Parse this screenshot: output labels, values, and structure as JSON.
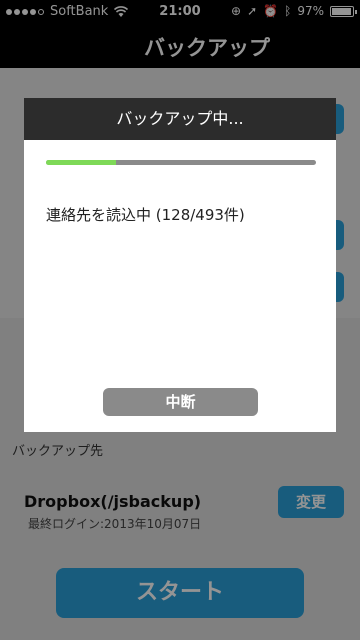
{
  "status_bar": {
    "carrier": "SoftBank",
    "time": "21:00",
    "battery": "97%",
    "signal_dots": 4,
    "battery_level": 0.97
  },
  "nav": {
    "title": "バックアップ"
  },
  "modal": {
    "title": "バックアップ中...",
    "status": "連絡先を読込中 (128/493件)",
    "progress": 0.26,
    "abort_label": "中断"
  },
  "background": {
    "backup_dest_label": "バックアップ先",
    "dest_value": "Dropbox(/jsbackup)",
    "last_login": "最終ログイン:2013年10月07日",
    "change_label": "変更",
    "start_label": "スタート"
  },
  "colors": {
    "accent": "#2a9fd8",
    "progress_fill": "#7ed957"
  }
}
